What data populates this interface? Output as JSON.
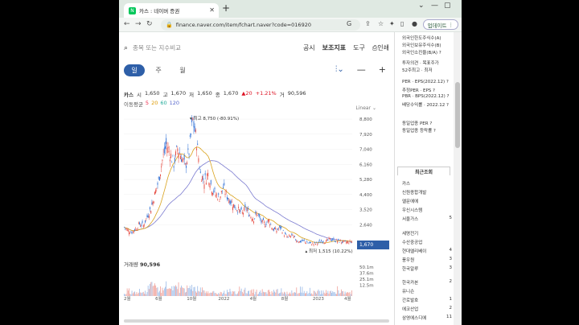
{
  "browser": {
    "tab_title": "카스 : 네이버 증권",
    "favicon": "N",
    "url": "finance.naver.com/item/fchart.naver?code=016920",
    "update_label": "업데이트",
    "colors": {
      "frame": "#dfe9e2",
      "accent": "#2e5fa8"
    }
  },
  "page": {
    "search_placeholder": "종목 또는 지수비교",
    "links": [
      "공시",
      "보조지표",
      "도구",
      "인쇄"
    ],
    "periods": [
      "일",
      "주",
      "월"
    ],
    "active_period": "일",
    "quote": {
      "name": "카스",
      "open_label": "시",
      "open": "1,650",
      "high_label": "고",
      "high": "1,670",
      "low_label": "저",
      "low": "1,650",
      "close_label": "종",
      "close": "1,670",
      "change": "▲20",
      "change_pct": "+1.21%",
      "volume_label": "거",
      "volume": "90,596"
    },
    "ma": {
      "label": "이동평균",
      "p5": "5",
      "p20": "20",
      "p60": "60",
      "p120": "120"
    },
    "scale_label": "Linear",
    "volume_title": "거래량",
    "volume_value": "90,596",
    "current_price_tag": "1,670"
  },
  "chart_data": {
    "type": "candlestick",
    "y_ticks": [
      "8,800",
      "7,920",
      "7,040",
      "6,160",
      "5,280",
      "4,400",
      "3,520",
      "2,640"
    ],
    "volume_ticks": [
      "50.1m",
      "37.6m",
      "25.1m",
      "12.5m"
    ],
    "x_ticks": [
      "2월",
      "6월",
      "10월",
      "2022",
      "4월",
      "8월",
      "2023",
      "4월"
    ],
    "annotations": {
      "high": "최고 8,750 (-80.91%)",
      "low": "최저 1,515 (10.22%)"
    },
    "close_series": [
      2500,
      2300,
      2200,
      2400,
      2700,
      2600,
      3100,
      3600,
      4400,
      5200,
      6400,
      7300,
      6800,
      6200,
      7100,
      6600,
      6000,
      6900,
      8750,
      7500,
      5600,
      5200,
      5600,
      4800,
      4400,
      4200,
      4800,
      4300,
      4000,
      3700,
      3500,
      3300,
      3600,
      3200,
      3000,
      3300,
      2800,
      2700,
      2900,
      2400,
      2300,
      2500,
      2100,
      1900,
      2000,
      1800,
      1650,
      1700,
      1600,
      1550,
      1515,
      1600,
      1700,
      1650,
      1800,
      1750,
      1700,
      1650,
      1600,
      1620,
      1670
    ]
  },
  "side_panel": {
    "items": [
      {
        "label": "외국인한도주식수(A)",
        "value": ""
      },
      {
        "label": "외국인보유주식수(B)",
        "value": ""
      },
      {
        "label": "외국인소진율(B/A)",
        "value": "?"
      },
      {
        "label": "투자의견 · 목표주가",
        "value": ""
      },
      {
        "label": "52주최고 · 최저",
        "value": ""
      },
      {
        "label": "PER · EPS(2022.12)",
        "value": "?"
      },
      {
        "label": "추정PER · EPS",
        "value": "?"
      },
      {
        "label": "PBR · BPS(2022.12)",
        "value": "?"
      },
      {
        "label": "배당수익률 · 2022.12",
        "value": "?"
      },
      {
        "label": "동일업종 PER",
        "value": "?"
      },
      {
        "label": "동일업종 등락률",
        "value": "?"
      }
    ],
    "recent_header": "최근조회",
    "recent": [
      {
        "label": "카스",
        "value": ""
      },
      {
        "label": "신원종합개발",
        "value": ""
      },
      {
        "label": "엘문에에",
        "value": ""
      },
      {
        "label": "우신시스템",
        "value": ""
      },
      {
        "label": "서울가스",
        "value": "5"
      },
      {
        "label": "세명전기",
        "value": ""
      },
      {
        "label": "수산중공업",
        "value": ""
      },
      {
        "label": "현대엘리베이",
        "value": "4"
      },
      {
        "label": "풍우원",
        "value": "3"
      },
      {
        "label": "한국알루",
        "value": "3"
      },
      {
        "label": "한국카본",
        "value": "2"
      },
      {
        "label": "유니슨",
        "value": ""
      },
      {
        "label": "간로발호",
        "value": "1"
      },
      {
        "label": "에코산업",
        "value": "2"
      },
      {
        "label": "삼영에스디에",
        "value": "11"
      }
    ]
  }
}
